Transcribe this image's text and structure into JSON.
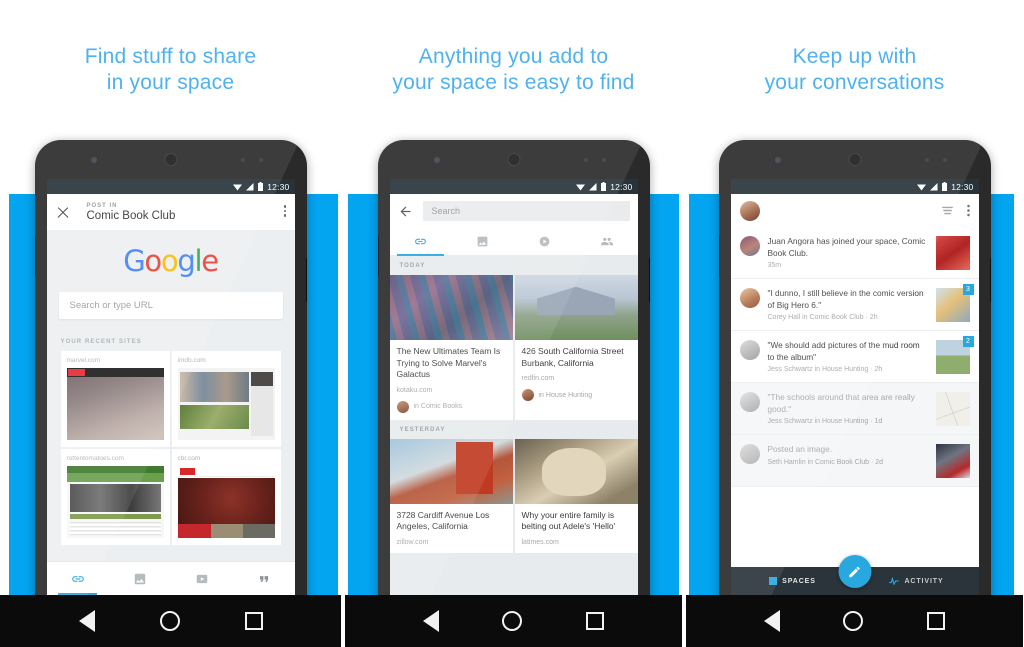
{
  "panels": [
    {
      "heading_line1": "Find stuff to share",
      "heading_line2": "in your space",
      "status": {
        "time": "12:30"
      },
      "appbar": {
        "post_in": "POST IN",
        "space_name": "Comic Book Club",
        "close_icon": "close-icon",
        "overflow_icon": "more-vert-icon"
      },
      "google": {
        "logo": "Google",
        "search_placeholder": "Search or type URL"
      },
      "recent": {
        "label": "YOUR RECENT SITES",
        "sites": [
          {
            "domain": "marvel.com"
          },
          {
            "domain": "imdb.com"
          },
          {
            "domain": "rottentomatoes.com"
          },
          {
            "domain": "cbr.com"
          }
        ]
      },
      "tabs": [
        {
          "name": "link-tab",
          "icon": "link-icon",
          "active": true
        },
        {
          "name": "image-tab",
          "icon": "image-icon",
          "active": false
        },
        {
          "name": "video-tab",
          "icon": "video-icon",
          "active": false
        },
        {
          "name": "quote-tab",
          "icon": "quote-icon",
          "active": false
        }
      ]
    },
    {
      "heading_line1": "Anything you add to",
      "heading_line2": "your space is easy to find",
      "status": {
        "time": "12:30"
      },
      "search": {
        "placeholder": "Search",
        "back_icon": "back-arrow-icon"
      },
      "tabs": [
        {
          "name": "link-tab",
          "icon": "link-icon",
          "active": true
        },
        {
          "name": "image-tab",
          "icon": "image-icon",
          "active": false
        },
        {
          "name": "video-tab",
          "icon": "video-icon",
          "active": false
        },
        {
          "name": "people-tab",
          "icon": "people-icon",
          "active": false
        }
      ],
      "groups": [
        {
          "day": "TODAY",
          "cards": [
            {
              "title": "The New Ultimates Team Is Trying to Solve Marvel's Galactus",
              "source": "kotaku.com",
              "space": "in Comic Books"
            },
            {
              "title": "426 South California Street Burbank, California",
              "source": "redfin.com",
              "space": "in House Hunting"
            }
          ]
        },
        {
          "day": "YESTERDAY",
          "cards": [
            {
              "title": "3728 Cardiff Avenue Los Angeles, California",
              "source": "zillow.com",
              "space": ""
            },
            {
              "title": "Why your entire family is belting out Adele's 'Hello'",
              "source": "latimes.com",
              "space": ""
            }
          ]
        }
      ]
    },
    {
      "heading_line1": "Keep up with",
      "heading_line2": "your conversations",
      "status": {
        "time": "12:30"
      },
      "appbar": {
        "avatar": "user-avatar",
        "filter_icon": "filter-icon",
        "overflow_icon": "more-vert-icon"
      },
      "activity": [
        {
          "main": "Juan Angora has joined your space, Comic Book Club.",
          "sub": "35m",
          "badge": "",
          "read": false
        },
        {
          "main": "\"I dunno, I still believe in the comic version of Big Hero 6.\"",
          "sub": "Corey Hall in Comic Book Club · 2h",
          "badge": "3",
          "read": false
        },
        {
          "main": "\"We should add pictures of the mud room to the album\"",
          "sub": "Jess Schwartz in House Hunting · 2h",
          "badge": "2",
          "read": false
        },
        {
          "main": "\"The schools around that area are really good.\"",
          "sub": "Jess Schwartz in House Hunting · 1d",
          "badge": "",
          "read": true
        },
        {
          "main": "Posted an image.",
          "sub": "Seth Hamlin in Comic Book Club · 2d",
          "badge": "",
          "read": true
        }
      ],
      "bottom": {
        "spaces_label": "SPACES",
        "activity_label": "ACTIVITY",
        "fab_icon": "pencil-icon"
      }
    }
  ],
  "nav": {
    "back_icon": "nav-back-icon",
    "home_icon": "nav-home-icon",
    "recents_icon": "nav-recents-icon"
  },
  "colors": {
    "accent": "#03A4F0",
    "heading": "#4FB2EF",
    "statusbar": "#27323a",
    "bottombar": "#2b333b"
  }
}
